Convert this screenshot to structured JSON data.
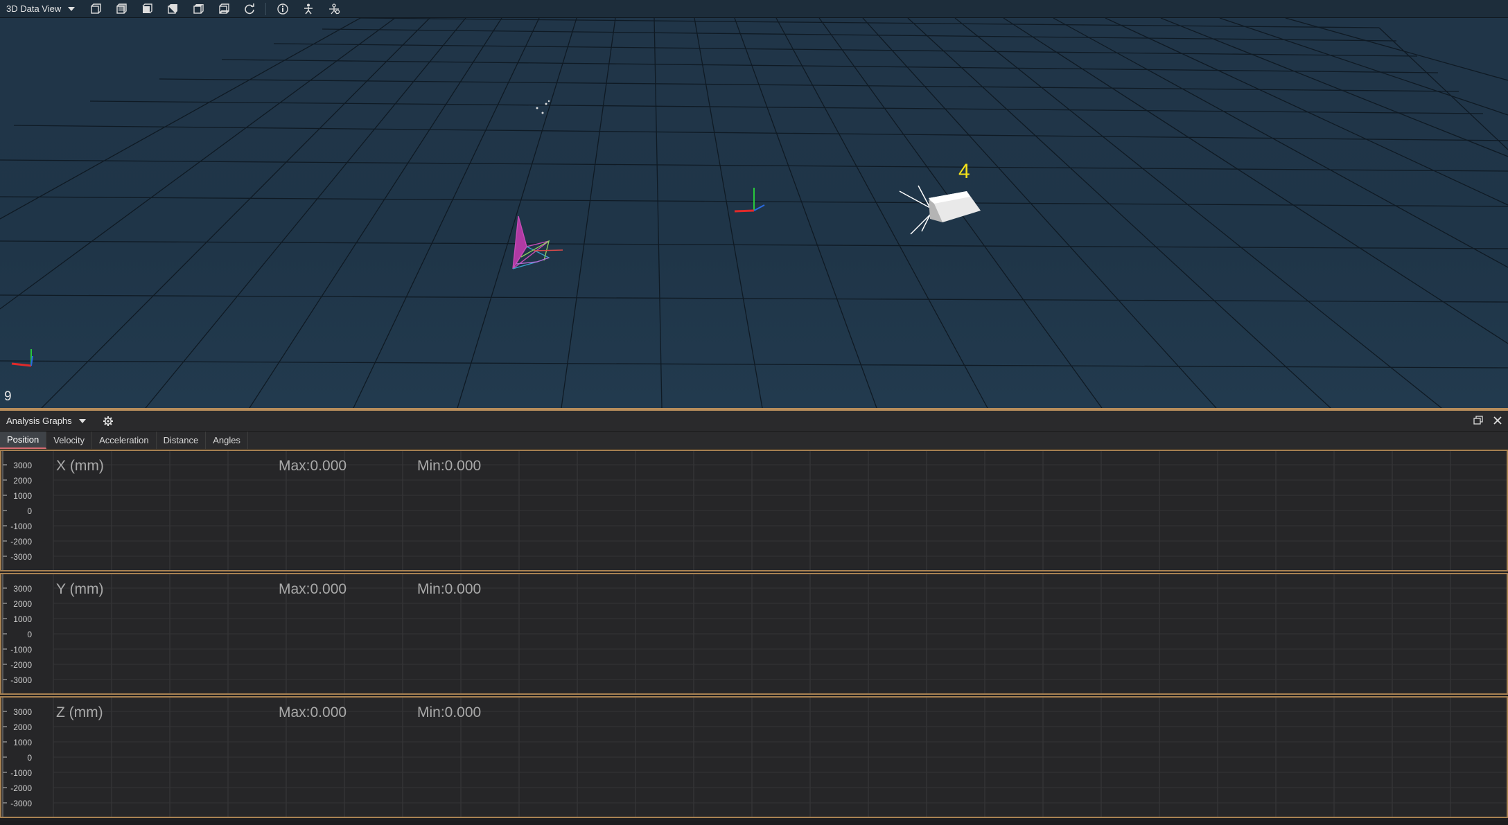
{
  "toolbar": {
    "view_selector": "3D Data View",
    "buttons": [
      {
        "icon": "view-front-icon"
      },
      {
        "icon": "view-back-icon"
      },
      {
        "icon": "view-left-icon"
      },
      {
        "icon": "view-right-icon"
      },
      {
        "icon": "view-top-icon"
      },
      {
        "icon": "view-bottom-icon"
      },
      {
        "icon": "reset-view-icon"
      },
      {
        "icon": "info-icon"
      },
      {
        "icon": "skeleton-icon"
      },
      {
        "icon": "marker-settings-icon"
      }
    ]
  },
  "viewport": {
    "frame_number": "9",
    "marker_label": "4",
    "colors": {
      "background": "#1f3548",
      "grid": "#0f1a24",
      "label": "#f5e21a"
    }
  },
  "panel": {
    "title": "Analysis Graphs",
    "tabs": [
      "Position",
      "Velocity",
      "Acceleration",
      "Distance",
      "Angles"
    ],
    "active_tab": "Position",
    "graphs": [
      {
        "title": "X (mm)",
        "max": "Max:0.000",
        "min": "Min:0.000",
        "ticks": [
          "3000",
          "2000",
          "1000",
          "0",
          "-1000",
          "-2000",
          "-3000"
        ]
      },
      {
        "title": "Y (mm)",
        "max": "Max:0.000",
        "min": "Min:0.000",
        "ticks": [
          "3000",
          "2000",
          "1000",
          "0",
          "-1000",
          "-2000",
          "-3000"
        ]
      },
      {
        "title": "Z (mm)",
        "max": "Max:0.000",
        "min": "Min:0.000",
        "ticks": [
          "3000",
          "2000",
          "1000",
          "0",
          "-1000",
          "-2000",
          "-3000"
        ]
      }
    ],
    "colors": {
      "graph_border": "#a98252",
      "active_tab_underline": "#d76b72"
    }
  }
}
